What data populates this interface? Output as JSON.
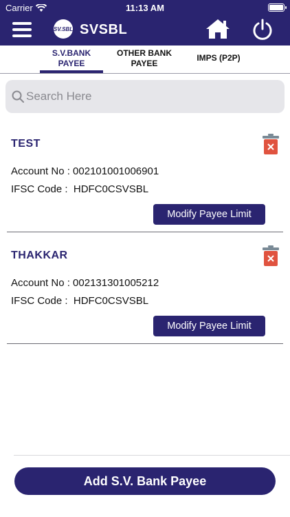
{
  "status_bar": {
    "carrier": "Carrier",
    "time": "11:13 AM",
    "wifi_icon": "wifi-icon",
    "battery_icon": "battery-icon"
  },
  "header": {
    "brand": "SVSBL",
    "logo_text": "SV.SBL",
    "menu_icon": "hamburger-menu-icon",
    "home_icon": "home-icon",
    "power_icon": "power-icon",
    "bg_color": "#2a2470"
  },
  "tabs": [
    {
      "label_line1": "S.V.BANK",
      "label_line2": "PAYEE",
      "active": true
    },
    {
      "label_line1": "OTHER BANK",
      "label_line2": "PAYEE",
      "active": false
    },
    {
      "label_line1": "IMPS (P2P)",
      "label_line2": "",
      "active": false
    }
  ],
  "search": {
    "placeholder": "Search Here",
    "value": ""
  },
  "payees": [
    {
      "name": "TEST",
      "account_label": "Account No : ",
      "account_no": "002101001006901",
      "ifsc_label": "IFSC Code :  ",
      "ifsc": "HDFC0CSVSBL",
      "button_label": "Modify Payee Limit"
    },
    {
      "name": "THAKKAR",
      "account_label": "Account No : ",
      "account_no": "002131301005212",
      "ifsc_label": "IFSC Code :  ",
      "ifsc": "HDFC0CSVSBL",
      "button_label": "Modify Payee Limit"
    }
  ],
  "footer": {
    "add_button_label": "Add S.V. Bank Payee"
  },
  "colors": {
    "primary": "#2a2470",
    "delete_red": "#e0533f",
    "trash_lid": "#7a8a96"
  }
}
